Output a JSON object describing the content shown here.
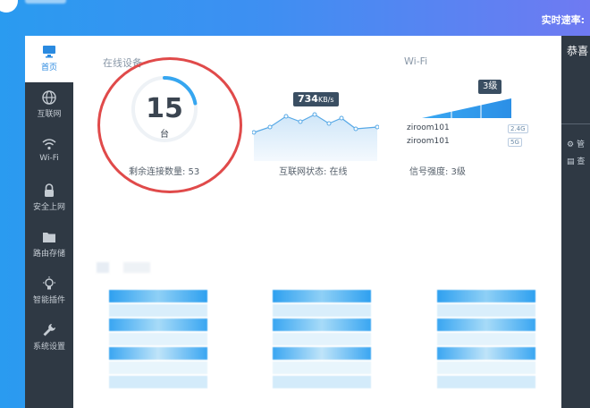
{
  "header": {
    "rate_label": "实时速率:"
  },
  "sidebar": {
    "items": [
      {
        "label": "首页",
        "icon": "monitor-icon",
        "active": true
      },
      {
        "label": "互联网",
        "icon": "globe-icon"
      },
      {
        "label": "Wi-Fi",
        "icon": "wifi-icon"
      },
      {
        "label": "安全上网",
        "icon": "lock-icon"
      },
      {
        "label": "路由存储",
        "icon": "folder-icon"
      },
      {
        "label": "智能插件",
        "icon": "lightbulb-icon"
      },
      {
        "label": "系统设置",
        "icon": "wrench-icon"
      }
    ]
  },
  "online_devices": {
    "title": "在线设备",
    "count": "15",
    "unit": "台",
    "remaining_label": "剩余连接数量: 53",
    "ring_progress": 0.22
  },
  "network": {
    "speed_value": "734",
    "speed_unit": "KB/s",
    "status_label": "互联网状态: 在线"
  },
  "wifi": {
    "title": "Wi-Fi",
    "level_badge": "3级",
    "networks": [
      {
        "ssid": "ziroom101",
        "band": "2.4G"
      },
      {
        "ssid": "ziroom101",
        "band": "5G"
      }
    ],
    "signal_label": "信号强度: 3级"
  },
  "right_panel": {
    "title": "恭喜",
    "items": [
      "管",
      "查"
    ]
  },
  "colors": {
    "accent": "#2a8ae0",
    "sidebar_bg": "#2f3944",
    "annotation_red": "#e04a4a"
  }
}
